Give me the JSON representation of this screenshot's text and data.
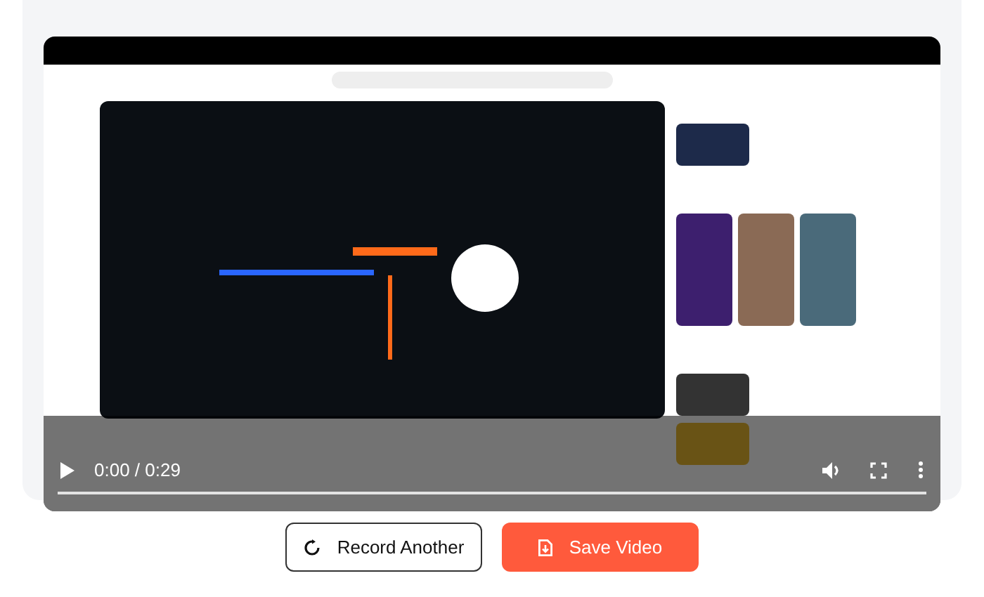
{
  "player": {
    "kind": "picture",
    "playing": false,
    "time": "0:00 / 0:29",
    "progress": {
      "level": 0
    }
  },
  "buttons": [
    {
      "label": "Record Another",
      "kind": "secondary"
    },
    {
      "label": "Save Video",
      "kind": "primary"
    }
  ]
}
